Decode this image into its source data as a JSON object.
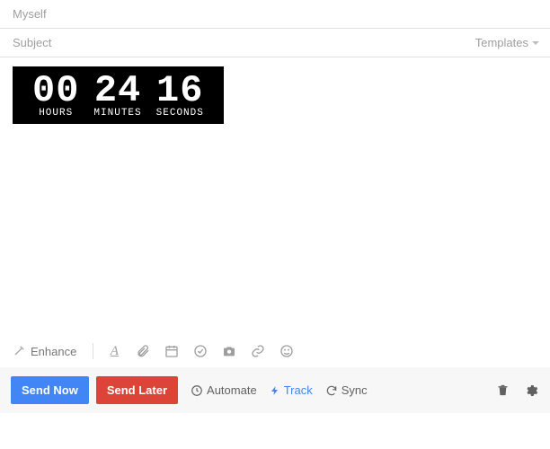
{
  "recipient": "Myself",
  "subject_placeholder": "Subject",
  "templates_label": "Templates",
  "countdown": {
    "hours": "00",
    "minutes": "24",
    "seconds": "16",
    "hours_label": "HOURS",
    "minutes_label": "MINUTES",
    "seconds_label": "SECONDS"
  },
  "toolbar": {
    "enhance": "Enhance"
  },
  "sendbar": {
    "send_now": "Send Now",
    "send_later": "Send Later",
    "automate": "Automate",
    "track": "Track",
    "sync": "Sync"
  }
}
